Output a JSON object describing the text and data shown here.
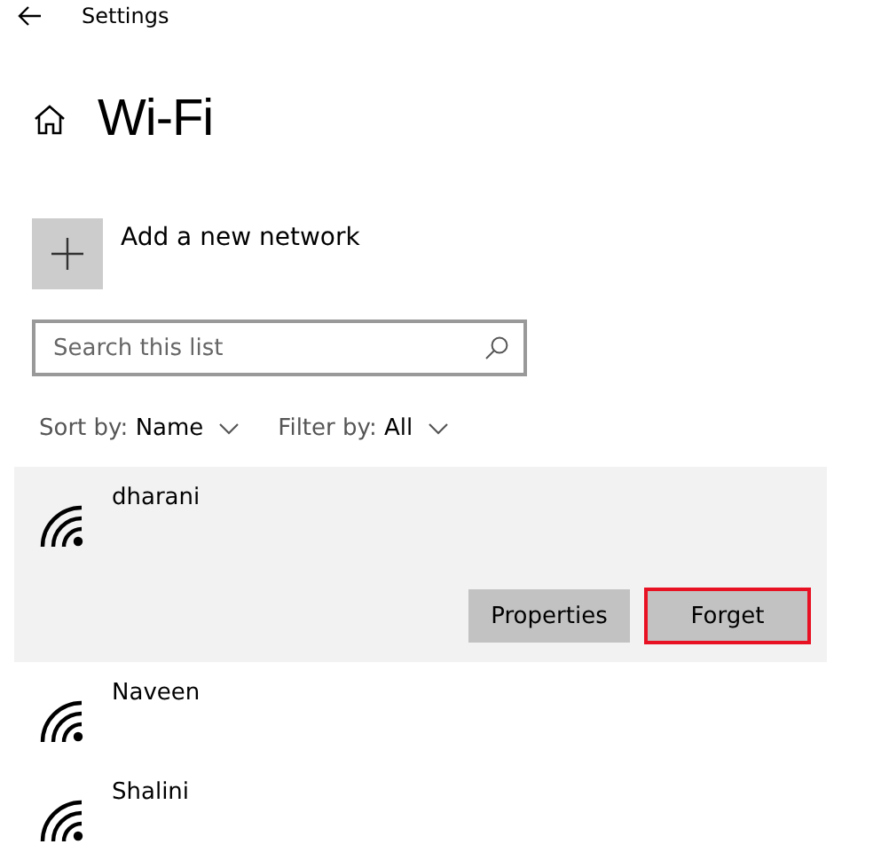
{
  "window": {
    "title": "Settings"
  },
  "page": {
    "title": "Wi-Fi"
  },
  "add_network": {
    "label": "Add a new network"
  },
  "search": {
    "placeholder": "Search this list"
  },
  "sort": {
    "label": "Sort by:",
    "value": "Name"
  },
  "filter": {
    "label": "Filter by:",
    "value": "All"
  },
  "networks": [
    {
      "name": "dharani",
      "selected": true,
      "buttons": [
        {
          "label": "Properties",
          "highlighted": false
        },
        {
          "label": "Forget",
          "highlighted": true
        }
      ]
    },
    {
      "name": "Naveen",
      "selected": false
    },
    {
      "name": "Shalini",
      "selected": false
    }
  ]
}
